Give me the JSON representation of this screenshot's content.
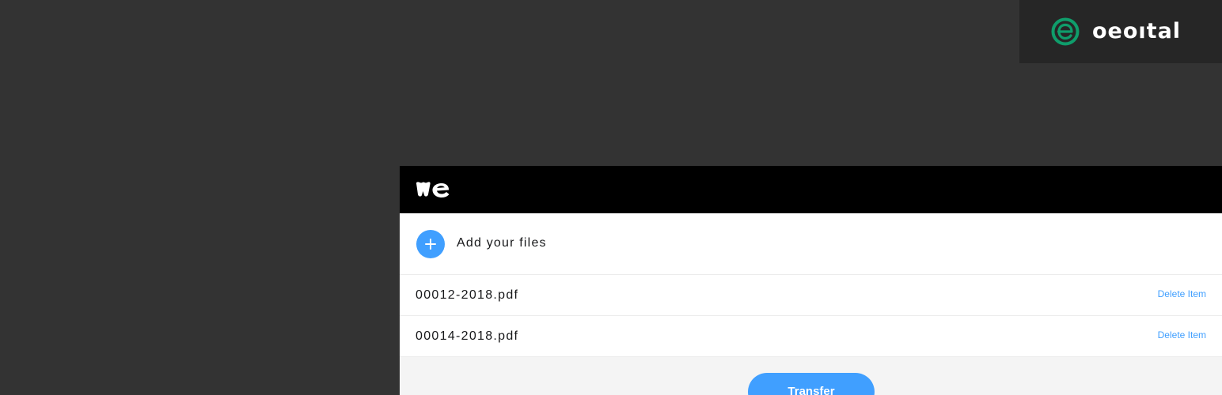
{
  "brand": {
    "wordmark": "oeoıtal",
    "logo_icon": "brand-e-logo-icon",
    "logo_color": "#0f9d6b"
  },
  "panel": {
    "logo_icon": "we-logo-icon",
    "add_files_label": "Add your files",
    "add_icon": "plus-icon",
    "accent_color": "#409fff",
    "files": [
      {
        "name": "00012-2018.pdf",
        "delete_label": "Delete Item"
      },
      {
        "name": "00014-2018.pdf",
        "delete_label": "Delete Item"
      }
    ],
    "transfer_label": "Transfer"
  }
}
